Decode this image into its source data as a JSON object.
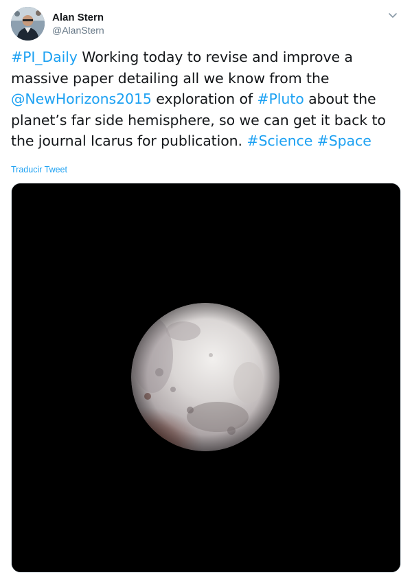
{
  "tweet": {
    "display_name": "Alan Stern",
    "handle": "@AlanStern",
    "avatar_icon": "user-photo-icon",
    "more_icon": "chevron-down-icon",
    "text_segments": [
      {
        "text": "#PI_Daily",
        "link": true
      },
      {
        "text": " Working today to revise and improve a massive paper detailing all we know from the ",
        "link": false
      },
      {
        "text": "@NewHorizons2015",
        "link": true
      },
      {
        "text": " exploration of ",
        "link": false
      },
      {
        "text": "#Pluto",
        "link": true
      },
      {
        "text": " about the planet’s far side hemisphere, so we can get it back to the journal Icarus for publication. ",
        "link": false
      },
      {
        "text": "#Science",
        "link": true
      },
      {
        "text": " ",
        "link": false
      },
      {
        "text": "#Space",
        "link": true
      }
    ],
    "translate_label": "Traducir Tweet",
    "media": {
      "subject": "pluto-image",
      "background_color": "#000000"
    }
  },
  "colors": {
    "link": "#1da1f2",
    "text": "#14171a",
    "secondary": "#657786"
  }
}
